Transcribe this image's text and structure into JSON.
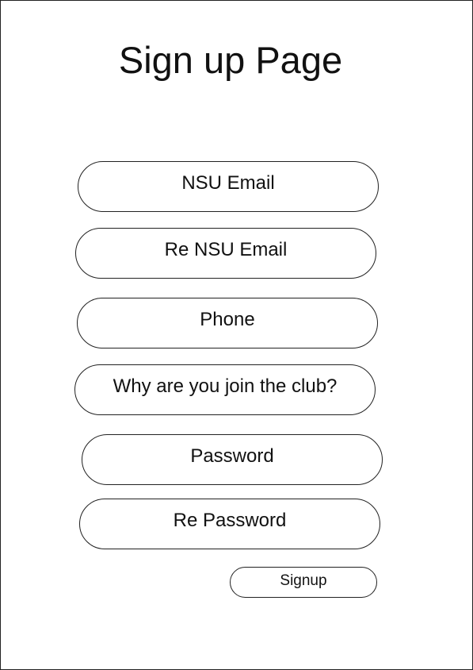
{
  "page": {
    "title": "Sign up Page"
  },
  "form": {
    "fields": [
      {
        "label": "NSU Email"
      },
      {
        "label": "Re NSU Email"
      },
      {
        "label": "Phone"
      },
      {
        "label": "Why are you join the club?"
      },
      {
        "label": "Password"
      },
      {
        "label": "Re Password"
      }
    ],
    "submit_label": "Signup"
  },
  "colors": {
    "border": "#222222",
    "text": "#111111",
    "background": "#ffffff"
  }
}
